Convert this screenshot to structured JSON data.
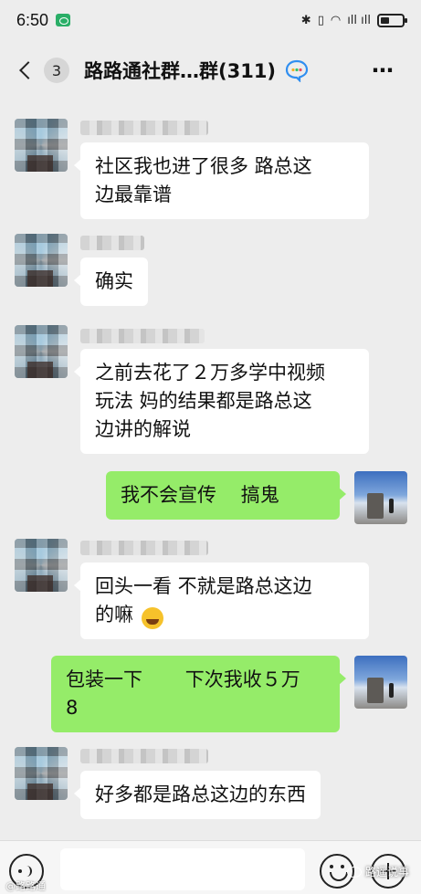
{
  "status_bar": {
    "time": "6:50",
    "signal_text": "ıll ıll",
    "icons": [
      "wechat-icon",
      "bluetooth-icon",
      "vibrate-icon",
      "wifi-icon",
      "signal-icon",
      "battery-icon"
    ]
  },
  "header": {
    "back_count": "3",
    "title": "路路通社群…群(311)",
    "more_label": "⋯"
  },
  "messages": [
    {
      "side": "left",
      "text": "社区我也进了很多 路总这\n边最靠谱"
    },
    {
      "side": "left",
      "text": "确实"
    },
    {
      "side": "left",
      "text": "之前去花了２万多学中视频\n玩法 妈的结果都是路总这\n边讲的解说"
    },
    {
      "side": "right",
      "text": "我不会宣传    搞鬼"
    },
    {
      "side": "left",
      "text": "回头一看 不就是路总这边\n的嘛"
    },
    {
      "side": "right",
      "text": "包装一下       下次我收５万\n8"
    },
    {
      "side": "left",
      "text": "好多都是路总这边的东西"
    }
  ],
  "input_bar": {
    "placeholder": ""
  },
  "watermarks": {
    "left": "@路路通",
    "right": "路遥说事"
  }
}
